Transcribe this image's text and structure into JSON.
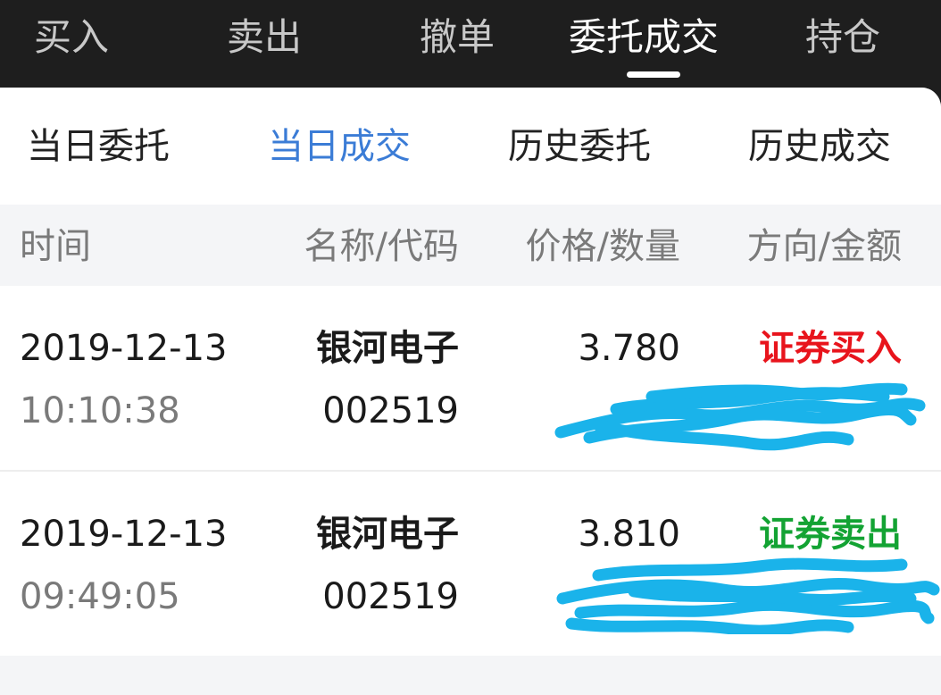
{
  "top_tabs": [
    {
      "label": "买入"
    },
    {
      "label": "卖出"
    },
    {
      "label": "撤单"
    },
    {
      "label": "委托成交"
    },
    {
      "label": "持仓"
    }
  ],
  "sub_tabs": [
    {
      "label": "当日委托"
    },
    {
      "label": "当日成交"
    },
    {
      "label": "历史委托"
    },
    {
      "label": "历史成交"
    }
  ],
  "table": {
    "headers": [
      "时间",
      "名称/代码",
      "价格/数量",
      "方向/金额"
    ],
    "rows": [
      {
        "date": "2019-12-13",
        "time": "10:10:38",
        "name": "银河电子",
        "code": "002519",
        "price": "3.780",
        "direction": "证券买入"
      },
      {
        "date": "2019-12-13",
        "time": "09:49:05",
        "name": "银河电子",
        "code": "002519",
        "price": "3.810",
        "direction": "证券卖出"
      }
    ]
  },
  "colors": {
    "accent": "#3b7cd6",
    "buy": "#e8141c",
    "sell": "#13a333",
    "redaction": "#1ab3ea"
  }
}
